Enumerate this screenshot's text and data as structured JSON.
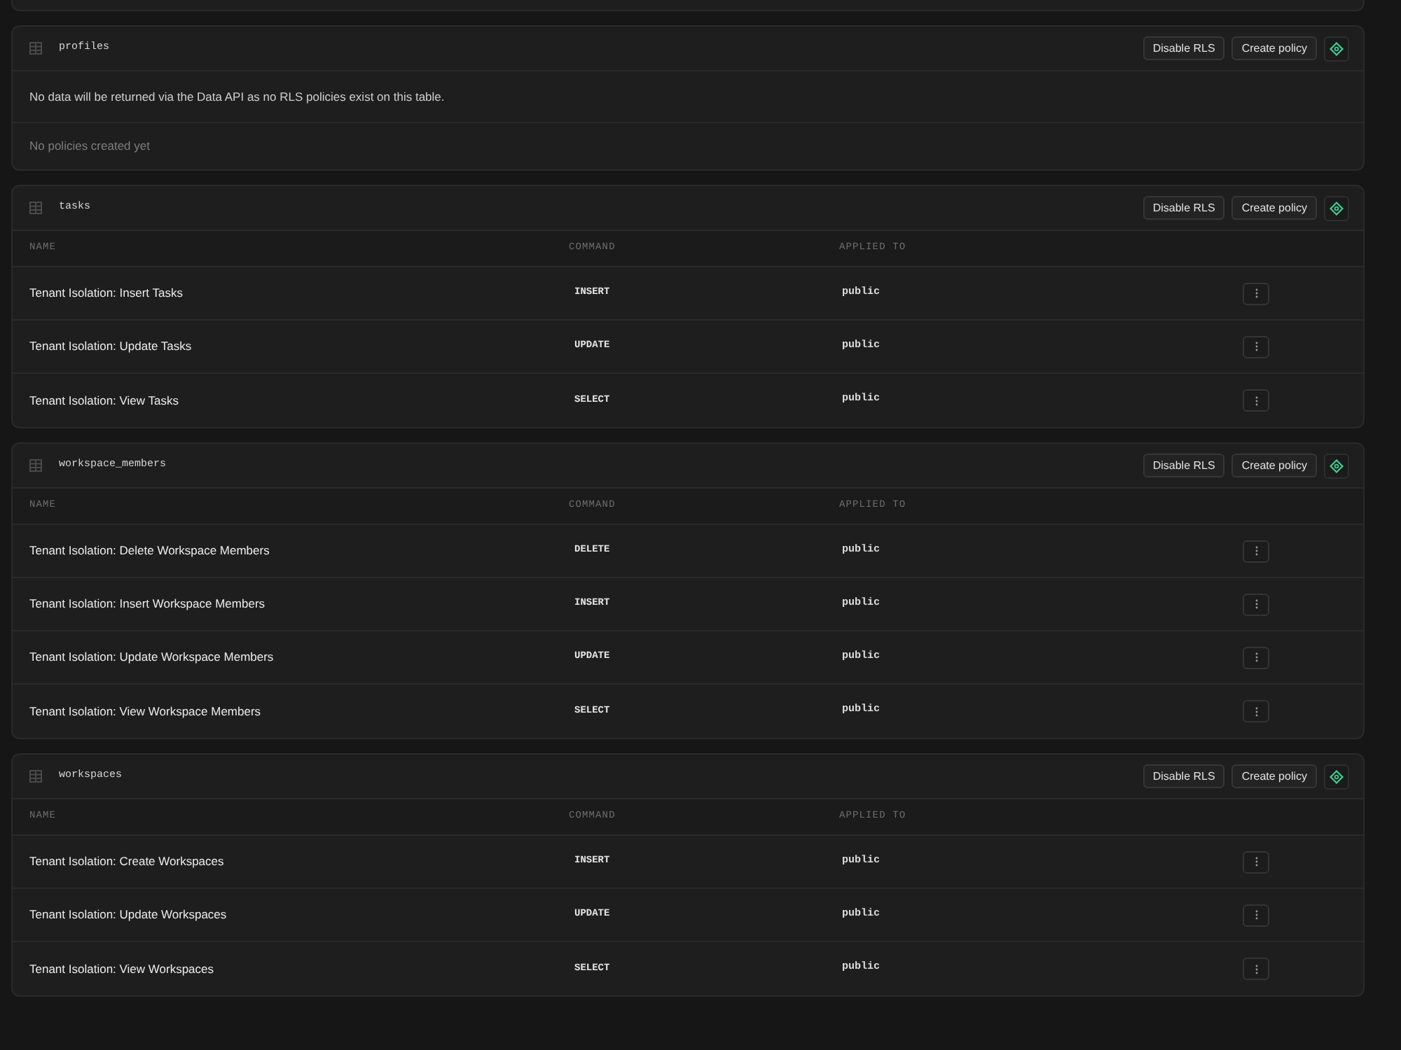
{
  "tables": [
    {
      "name": "profiles",
      "kind": "empty",
      "buttons": [
        "Disable RLS",
        "Create policy"
      ],
      "notice": "No data will be returned via the Data API as no RLS policies exist on this table.",
      "empty_text": "No policies created yet"
    },
    {
      "name": "tasks",
      "kind": "policies",
      "buttons": [
        "Disable RLS",
        "Create policy"
      ],
      "columns": [
        "NAME",
        "COMMAND",
        "APPLIED TO"
      ],
      "rows": [
        {
          "name": "Tenant Isolation: Insert Tasks",
          "command": "INSERT",
          "applied_to": "public"
        },
        {
          "name": "Tenant Isolation: Update Tasks",
          "command": "UPDATE",
          "applied_to": "public"
        },
        {
          "name": "Tenant Isolation: View Tasks",
          "command": "SELECT",
          "applied_to": "public"
        }
      ]
    },
    {
      "name": "workspace_members",
      "kind": "policies",
      "buttons": [
        "Disable RLS",
        "Create policy"
      ],
      "columns": [
        "NAME",
        "COMMAND",
        "APPLIED TO"
      ],
      "rows": [
        {
          "name": "Tenant Isolation: Delete Workspace Members",
          "command": "DELETE",
          "applied_to": "public"
        },
        {
          "name": "Tenant Isolation: Insert Workspace Members",
          "command": "INSERT",
          "applied_to": "public"
        },
        {
          "name": "Tenant Isolation: Update Workspace Members",
          "command": "UPDATE",
          "applied_to": "public"
        },
        {
          "name": "Tenant Isolation: View Workspace Members",
          "command": "SELECT",
          "applied_to": "public"
        }
      ]
    },
    {
      "name": "workspaces",
      "kind": "policies",
      "buttons": [
        "Disable RLS",
        "Create policy"
      ],
      "columns": [
        "NAME",
        "COMMAND",
        "APPLIED TO"
      ],
      "rows": [
        {
          "name": "Tenant Isolation: Create Workspaces",
          "command": "INSERT",
          "applied_to": "public"
        },
        {
          "name": "Tenant Isolation: Update Workspaces",
          "command": "UPDATE",
          "applied_to": "public"
        },
        {
          "name": "Tenant Isolation: View Workspaces",
          "command": "SELECT",
          "applied_to": "public"
        }
      ]
    }
  ]
}
